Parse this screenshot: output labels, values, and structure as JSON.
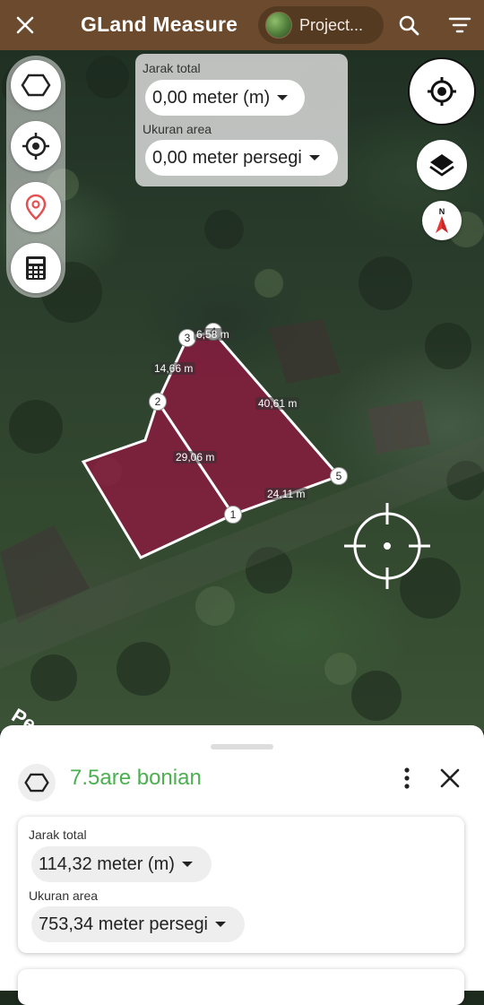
{
  "app": {
    "title": "GLand Measure",
    "project_chip_label": "Project...",
    "bar_color": "#6b4a2e"
  },
  "icons": {
    "close": "close-icon",
    "search": "search-icon",
    "filter": "filter-icon",
    "polygon": "polygon-icon",
    "crosshair": "crosshair-icon",
    "pin": "map-pin-icon",
    "calculator": "calculator-icon",
    "gps": "gps-icon",
    "layers": "layers-icon",
    "compass": "compass-north-icon"
  },
  "overlay": {
    "distance_caption": "Jarak total",
    "distance_value": "0,00 meter (m)",
    "area_caption": "Ukuran area",
    "area_value": "0,00 meter persegi"
  },
  "compass_letter": "N",
  "map": {
    "polygon_fill": "#8b1a3f",
    "vertices": [
      "1",
      "2",
      "3",
      "4",
      "5"
    ],
    "segments": [
      "14,66 m",
      "40,61 m",
      "29,06 m",
      "24,11 m",
      "6,58 m"
    ],
    "road_text": "Pe"
  },
  "sheet": {
    "plot_name": "7.5are bonian",
    "plot_name_color": "#4caf50",
    "distance_caption": "Jarak total",
    "distance_value": "114,32 meter (m)",
    "area_caption": "Ukuran area",
    "area_value": "753,34 meter persegi"
  }
}
